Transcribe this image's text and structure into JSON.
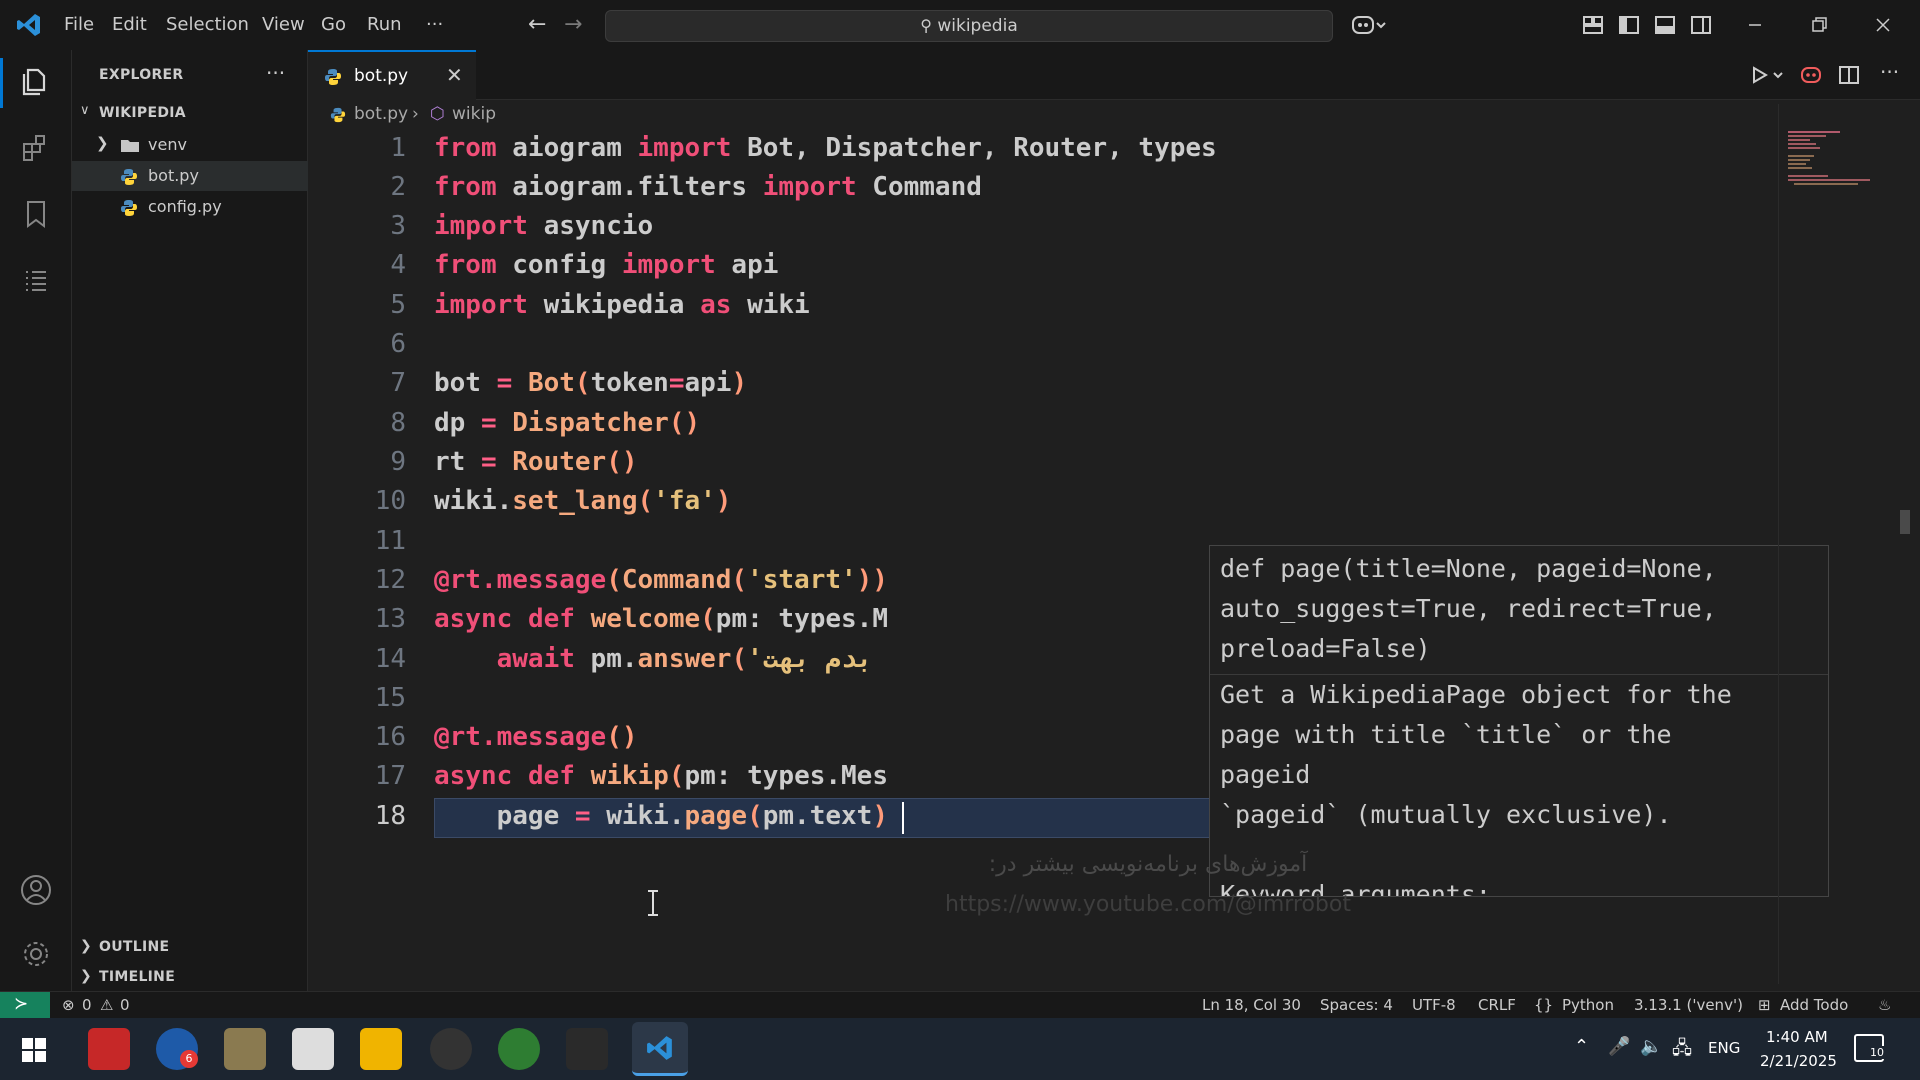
{
  "titlebar": {
    "menu": [
      "File",
      "Edit",
      "Selection",
      "View",
      "Go",
      "Run",
      "···"
    ],
    "search_text": "wikipedia"
  },
  "sidebar": {
    "explorer_title": "EXPLORER",
    "more": "···",
    "folder": "WIKIPEDIA",
    "items": [
      {
        "label": "venv",
        "type": "folder"
      },
      {
        "label": "bot.py",
        "type": "python"
      },
      {
        "label": "config.py",
        "type": "python"
      }
    ],
    "outline": "OUTLINE",
    "timeline": "TIMELINE"
  },
  "tabs": [
    {
      "label": "bot.py",
      "active": true
    }
  ],
  "breadcrumb": {
    "file": "bot.py",
    "symbol": "wikip"
  },
  "editor": {
    "current_line": "18",
    "line_numbers": [
      "1",
      "2",
      "3",
      "4",
      "5",
      "6",
      "7",
      "8",
      "9",
      "10",
      "11",
      "12",
      "13",
      "14",
      "15",
      "16",
      "17",
      "18"
    ]
  },
  "hover": {
    "signature": [
      "def page(title=None, pageid=None,",
      "auto_suggest=True, redirect=True,",
      "preload=False)"
    ],
    "doc": [
      "Get a WikipediaPage object for the",
      "page with title `title` or the",
      "pageid",
      "`pageid` (mutually exclusive).",
      "",
      "Keyword arguments:"
    ]
  },
  "watermark": {
    "line1": "آموزش‌های برنامه‌نویسی بیشتر در:",
    "line2": "https://www.youtube.com/@imrrobot"
  },
  "statusbar": {
    "errors": "0",
    "warnings": "0",
    "position": "Ln 18, Col 30",
    "spaces": "Spaces: 4",
    "encoding": "UTF-8",
    "eol": "CRLF",
    "language": "Python",
    "interpreter": "3.13.1 ('venv')",
    "todo": "Add Todo"
  },
  "taskbar": {
    "lang": "ENG",
    "time": "1:40 AM",
    "date": "2/21/2025",
    "notif_count": "10",
    "badge": "6"
  },
  "colors": {
    "accent": "#0078d4",
    "remote": "#16825d"
  }
}
